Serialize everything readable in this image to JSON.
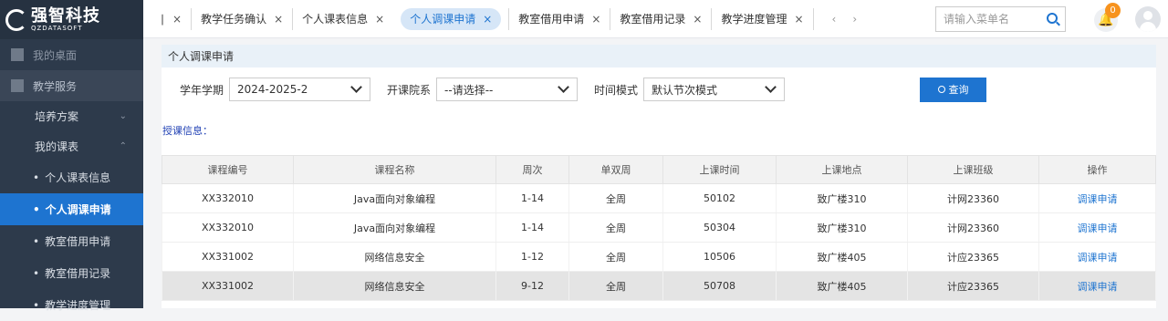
{
  "logo": {
    "cn": "强智科技",
    "en": "QZDATASOFT"
  },
  "sidebar": {
    "items": [
      {
        "label": "我的桌面"
      },
      {
        "label": "教学服务"
      }
    ],
    "groups": [
      {
        "label": "培养方案",
        "chev": "⌄"
      },
      {
        "label": "我的课表",
        "chev": "⌃"
      }
    ],
    "leaves": [
      {
        "label": "个人课表信息"
      },
      {
        "label": "个人调课申请"
      },
      {
        "label": "教室借用申请"
      },
      {
        "label": "教室借用记录"
      },
      {
        "label": "教学进度管理"
      }
    ]
  },
  "tabs": [
    {
      "label": "∣",
      "close": "×"
    },
    {
      "label": "教学任务确认",
      "close": "×"
    },
    {
      "label": "个人课表信息",
      "close": "×"
    },
    {
      "label": "个人调课申请",
      "close": "×"
    },
    {
      "label": "教室借用申请",
      "close": "×"
    },
    {
      "label": "教室借用记录",
      "close": "×"
    },
    {
      "label": "教学进度管理",
      "close": "×"
    }
  ],
  "nav": {
    "prev": "‹",
    "next": "›"
  },
  "search": {
    "placeholder": "请输入菜单名"
  },
  "notification": {
    "count": "0"
  },
  "page": {
    "title": "个人调课申请"
  },
  "filters": {
    "term_label": "学年学期",
    "term_value": "2024-2025-2",
    "college_label": "开课院系",
    "college_value": "--请选择--",
    "mode_label": "时间模式",
    "mode_value": "默认节次模式",
    "query_label": "查询"
  },
  "section_label": "授课信息：",
  "table": {
    "headers": [
      "课程编号",
      "课程名称",
      "周次",
      "单双周",
      "上课时间",
      "上课地点",
      "上课班级",
      "操作"
    ],
    "rows": [
      [
        "XX332010",
        "Java面向对象编程",
        "1-14",
        "全周",
        "50102",
        "致广楼310",
        "计网23360",
        "调课申请"
      ],
      [
        "XX332010",
        "Java面向对象编程",
        "1-14",
        "全周",
        "50304",
        "致广楼310",
        "计网23360",
        "调课申请"
      ],
      [
        "XX331002",
        "网络信息安全",
        "1-12",
        "全周",
        "10506",
        "致广楼405",
        "计应23365",
        "调课申请"
      ],
      [
        "XX331002",
        "网络信息安全",
        "9-12",
        "全周",
        "50708",
        "致广楼405",
        "计应23365",
        "调课申请"
      ]
    ]
  },
  "colors": {
    "accent": "#1e74d0",
    "sidebar_bg": "#2d3a4b",
    "badge": "#f7931e"
  }
}
